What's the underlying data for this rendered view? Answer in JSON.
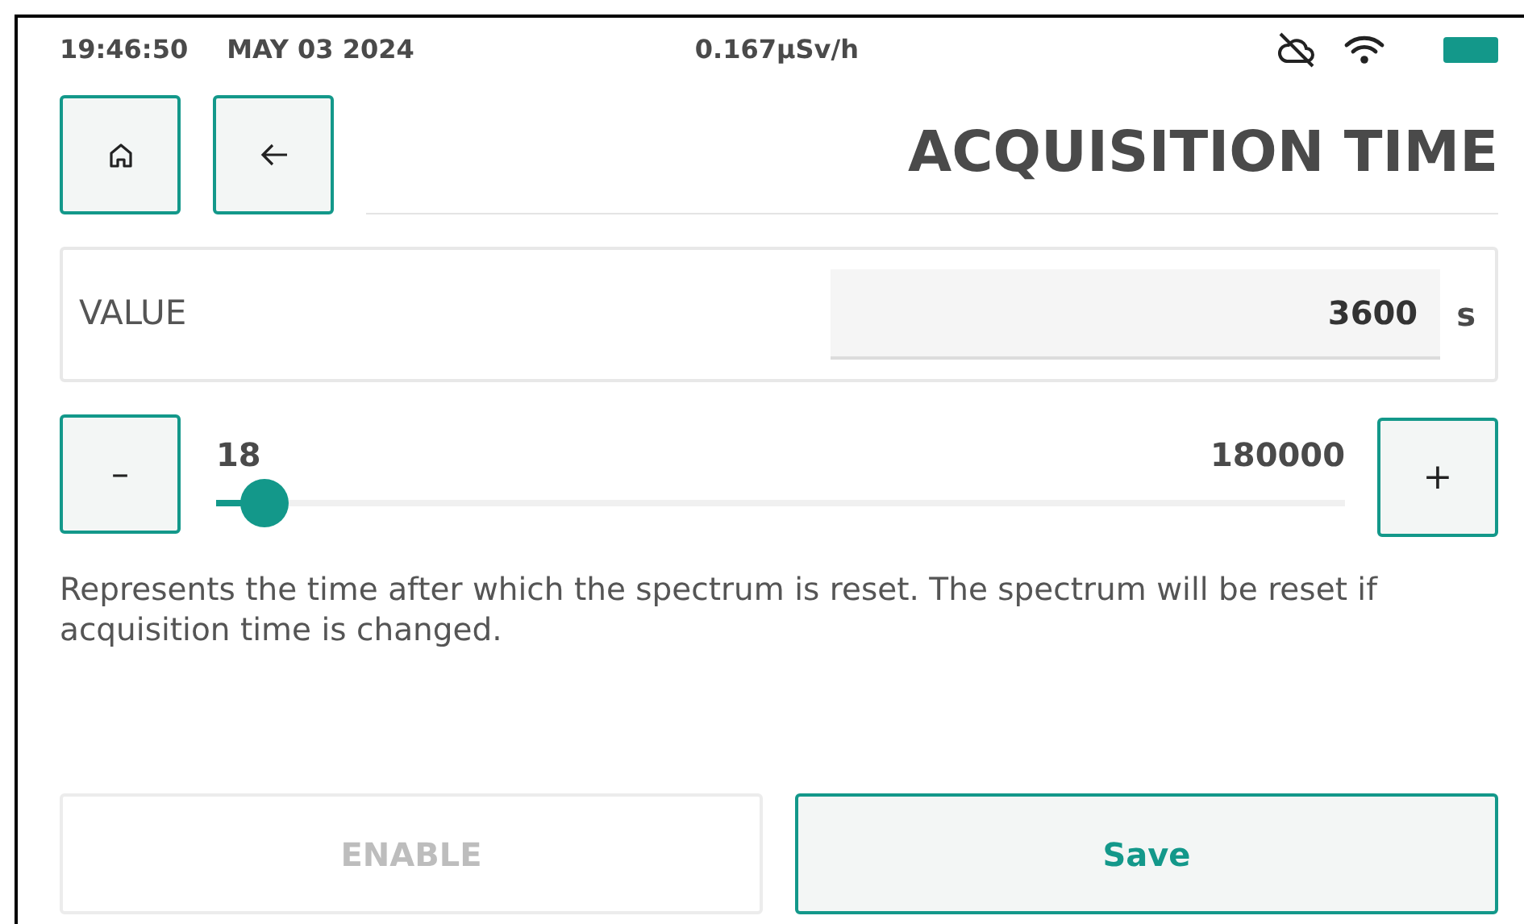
{
  "status_bar": {
    "time": "19:46:50",
    "date": "MAY 03 2024",
    "dose_rate": "0.167µSv/h"
  },
  "title": "ACQUISITION TIME",
  "value": {
    "label": "VALUE",
    "value": "3600",
    "unit": "s"
  },
  "slider": {
    "min": "18",
    "max": "180000",
    "level": 0.043,
    "minus": "–",
    "plus": "+"
  },
  "description": "Represents the time after which the spectrum is reset. The spectrum will be reset if acquisition time is changed.",
  "buttons": [
    {
      "label": "ENABLE",
      "disabled": true
    },
    {
      "label": "Save",
      "disabled": false
    }
  ]
}
